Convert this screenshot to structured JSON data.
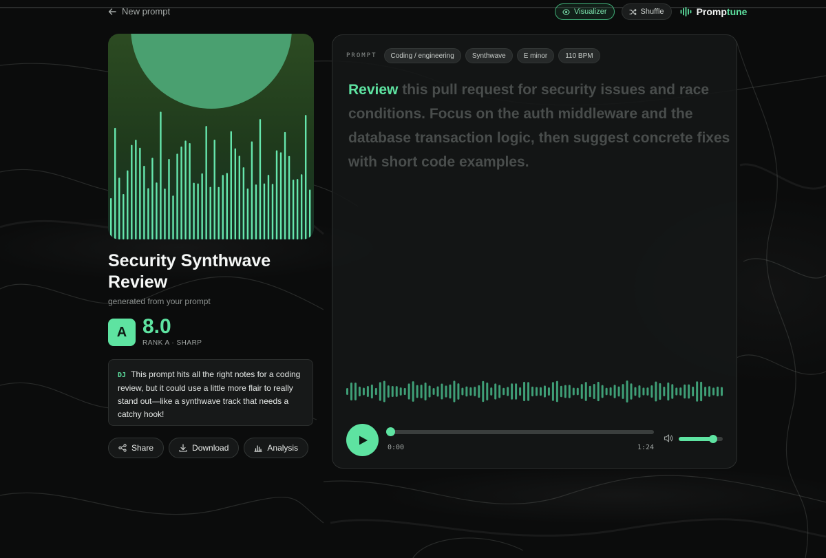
{
  "header": {
    "back_label": "New prompt",
    "visualizer_label": "Visualizer",
    "shuffle_label": "Shuffle",
    "brand_part1": "Promp",
    "brand_part2": "tune"
  },
  "track": {
    "title": "Security Synthwave Review",
    "subtitle": "generated from your prompt",
    "rank_letter": "A",
    "score": "8.0",
    "rank_label": "RANK A · SHARP"
  },
  "dj": {
    "tag": "DJ",
    "comment": "This prompt hits all the right notes for a coding review, but it could use a little more flair to really stand out—like a synthwave track that needs a catchy hook!"
  },
  "actions": {
    "share_label": "Share",
    "download_label": "Download",
    "analysis_label": "Analysis"
  },
  "prompt": {
    "label": "PROMPT",
    "tags": [
      "Coding / engineering",
      "Synthwave",
      "E minor",
      "110 BPM"
    ],
    "highlight": "Review",
    "rest": " this pull request for security issues and race conditions. Focus on the auth middleware and the database transaction logic, then suggest concrete fixes with short code examples."
  },
  "player": {
    "current_time": "0:00",
    "total_time": "1:24",
    "progress": 0,
    "volume": 0.78
  },
  "colors": {
    "accent": "#5ee3a1",
    "panel": "#151717",
    "background": "#0b0c0c"
  },
  "icons": {
    "back": "arrow-left-icon",
    "visualizer": "eye-icon",
    "shuffle": "shuffle-icon",
    "brand": "waveform-logo-icon",
    "share": "share-icon",
    "download": "download-icon",
    "analysis": "bar-chart-icon",
    "play": "play-icon",
    "volume": "volume-icon"
  }
}
